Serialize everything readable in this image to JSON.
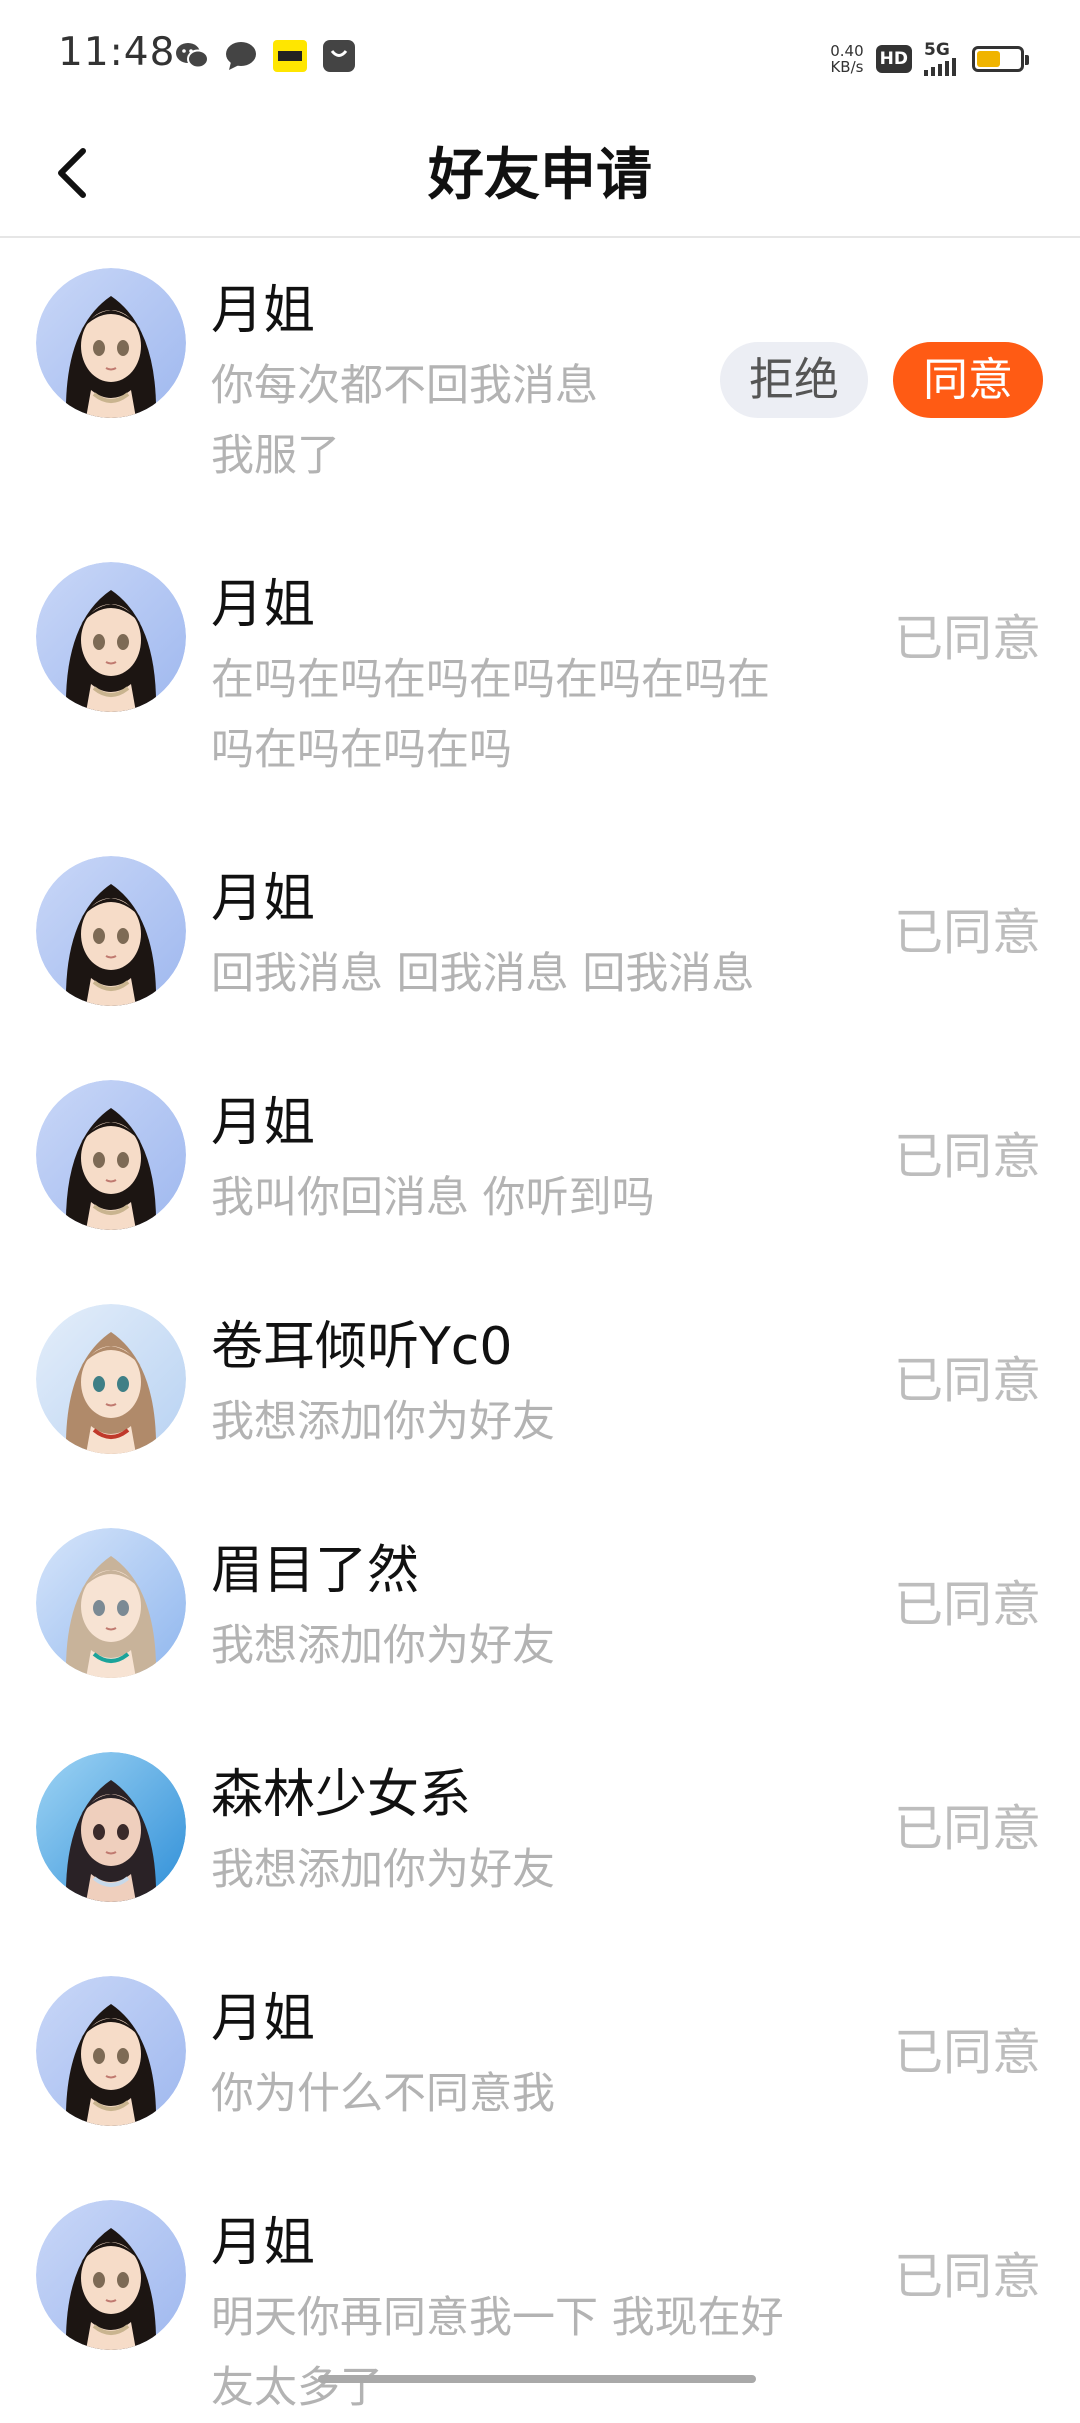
{
  "status_bar": {
    "time": "11:48",
    "left_icons": [
      "wechat-icon",
      "message-icon",
      "kuaikan-icon",
      "bag-icon"
    ],
    "net_speed_value": "0.40",
    "net_speed_unit": "KB/s",
    "hd_label": "HD",
    "signal_label": "5G",
    "battery_level": 0.55,
    "battery_color": "#f0b400"
  },
  "header": {
    "title": "好友申请",
    "back_icon": "chevron-left-icon"
  },
  "colors": {
    "accent": "#ff5b14",
    "reject_bg": "#eceef4",
    "muted_text": "#b3b3b3"
  },
  "actions": {
    "reject_label": "拒绝",
    "accept_label": "同意",
    "accepted_label": "已同意"
  },
  "requests": [
    {
      "name": "月姐",
      "message": "你每次都不回我消息\n我服了",
      "status": "pending",
      "avatar": "dark-hair-girl-avatar"
    },
    {
      "name": "月姐",
      "message": "在吗在吗在吗在吗在吗在吗在\n吗在吗在吗在吗",
      "status": "accepted",
      "avatar": "dark-hair-girl-avatar"
    },
    {
      "name": "月姐",
      "message": "回我消息 回我消息 回我消息",
      "status": "accepted",
      "avatar": "dark-hair-girl-avatar"
    },
    {
      "name": "月姐",
      "message": "我叫你回消息 你听到吗",
      "status": "accepted",
      "avatar": "dark-hair-girl-avatar"
    },
    {
      "name": "卷耳倾听Yc0",
      "message": "我想添加你为好友",
      "status": "accepted",
      "avatar": "light-brown-hair-girl-avatar"
    },
    {
      "name": "眉目了然",
      "message": "我想添加你为好友",
      "status": "accepted",
      "avatar": "blonde-ponytail-girl-avatar"
    },
    {
      "name": "森林少女系",
      "message": "我想添加你为好友",
      "status": "accepted",
      "avatar": "illustrated-girl-avatar"
    },
    {
      "name": "月姐",
      "message": "你为什么不同意我",
      "status": "accepted",
      "avatar": "dark-hair-girl-avatar"
    },
    {
      "name": "月姐",
      "message": "明天你再同意我一下 我现在好\n友太多了",
      "status": "accepted",
      "avatar": "dark-hair-girl-avatar"
    }
  ]
}
